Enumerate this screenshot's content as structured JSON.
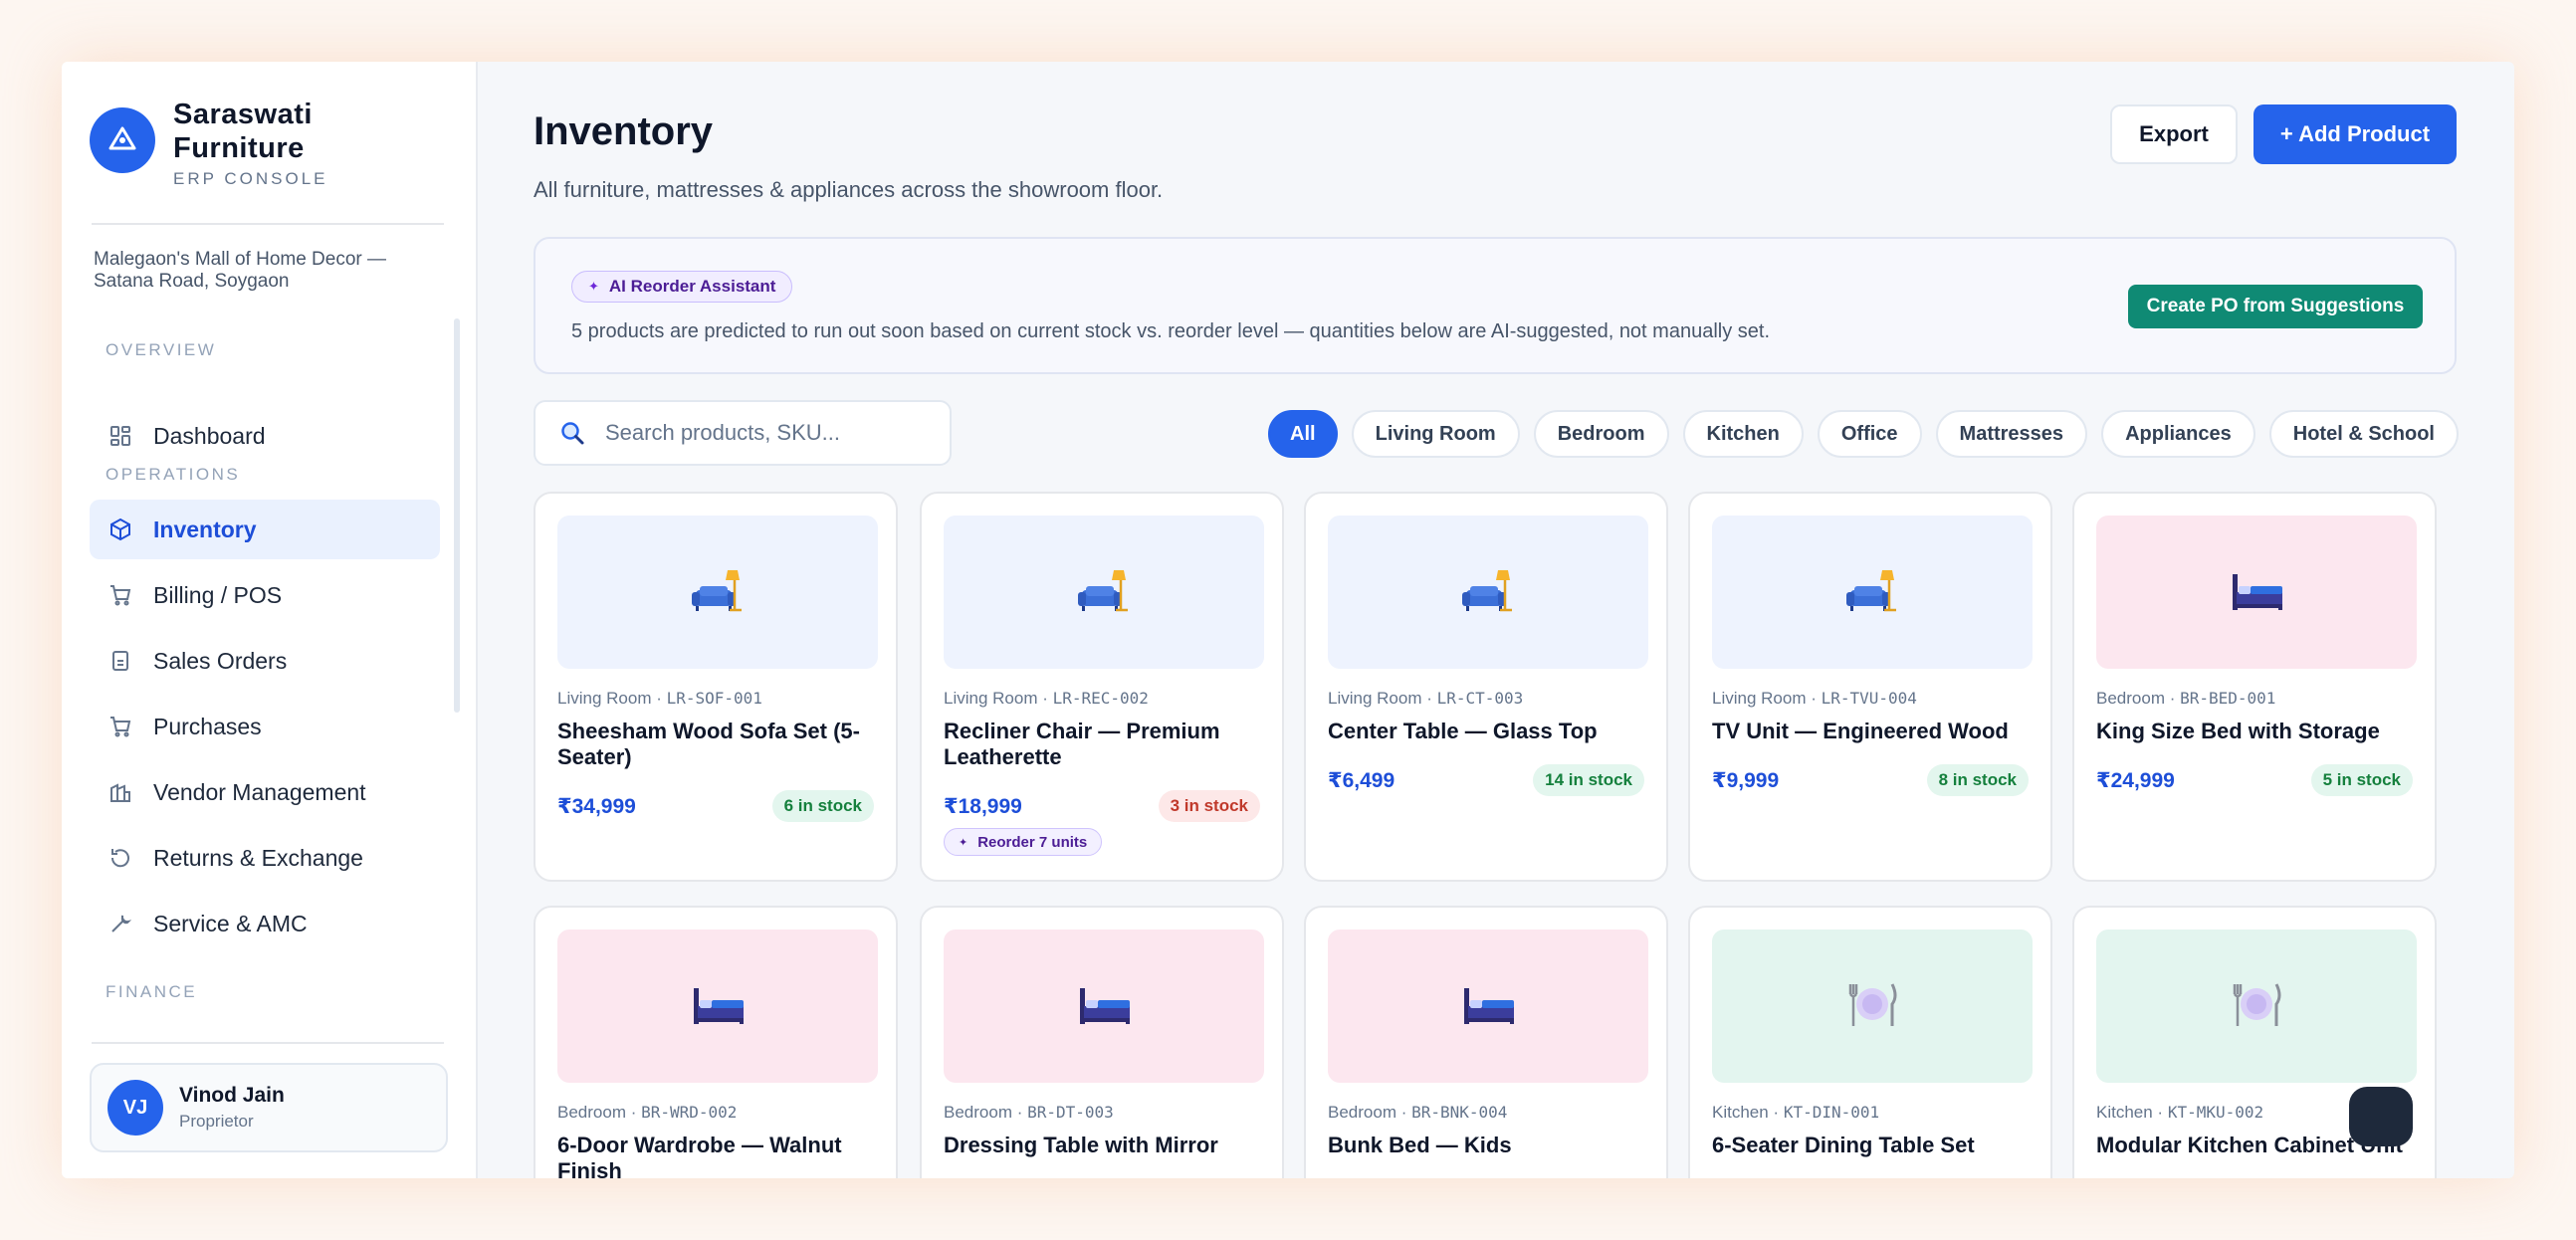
{
  "brand": {
    "name": "Saraswati Furniture",
    "subtitle": "ERP CONSOLE",
    "location": "Malegaon's Mall of Home Decor — Satana Road, Soygaon"
  },
  "sidebar": {
    "sections": {
      "overview": "OVERVIEW",
      "operations": "OPERATIONS",
      "finance": "FINANCE"
    },
    "items": [
      {
        "label": "Dashboard",
        "icon": "grid-icon"
      },
      {
        "label": "Inventory",
        "icon": "box-icon",
        "active": true
      },
      {
        "label": "Billing / POS",
        "icon": "cart-icon"
      },
      {
        "label": "Sales Orders",
        "icon": "document-icon"
      },
      {
        "label": "Purchases",
        "icon": "cart-icon"
      },
      {
        "label": "Vendor Management",
        "icon": "building-icon"
      },
      {
        "label": "Returns & Exchange",
        "icon": "refresh-icon"
      },
      {
        "label": "Service & AMC",
        "icon": "wrench-icon"
      }
    ]
  },
  "user": {
    "initials": "VJ",
    "name": "Vinod Jain",
    "role": "Proprietor"
  },
  "header": {
    "title": "Inventory",
    "subtitle": "All furniture, mattresses & appliances across the showroom floor.",
    "export_label": "Export",
    "add_label": "+ Add Product"
  },
  "ai": {
    "badge": "AI Reorder Assistant",
    "text": "5 products are predicted to run out soon based on current stock vs. reorder level — quantities below are AI-suggested, not manually set.",
    "button": "Create PO from Suggestions"
  },
  "search": {
    "placeholder": "Search products, SKU..."
  },
  "filters": [
    "All",
    "Living Room",
    "Bedroom",
    "Kitchen",
    "Office",
    "Mattresses",
    "Appliances",
    "Hotel & School"
  ],
  "active_filter": "All",
  "products": [
    {
      "category": "Living Room",
      "sku": "LR-SOF-001",
      "name": "Sheesham Wood Sofa Set (5-Seater)",
      "price": "₹34,999",
      "stock": "6 in stock",
      "status": "ok",
      "icon": "sofa-lamp-icon"
    },
    {
      "category": "Living Room",
      "sku": "LR-REC-002",
      "name": "Recliner Chair — Premium Leatherette",
      "price": "₹18,999",
      "stock": "3 in stock",
      "status": "low",
      "reorder": "Reorder 7 units",
      "icon": "sofa-lamp-icon"
    },
    {
      "category": "Living Room",
      "sku": "LR-CT-003",
      "name": "Center Table — Glass Top",
      "price": "₹6,499",
      "stock": "14 in stock",
      "status": "ok",
      "icon": "sofa-lamp-icon"
    },
    {
      "category": "Living Room",
      "sku": "LR-TVU-004",
      "name": "TV Unit — Engineered Wood",
      "price": "₹9,999",
      "stock": "8 in stock",
      "status": "ok",
      "icon": "sofa-lamp-icon"
    },
    {
      "category": "Bedroom",
      "sku": "BR-BED-001",
      "name": "King Size Bed with Storage",
      "price": "₹24,999",
      "stock": "5 in stock",
      "status": "ok",
      "icon": "bed-icon"
    },
    {
      "category": "Bedroom",
      "sku": "BR-WRD-002",
      "name": "6-Door Wardrobe — Walnut Finish",
      "icon": "bed-icon"
    },
    {
      "category": "Bedroom",
      "sku": "BR-DT-003",
      "name": "Dressing Table with Mirror",
      "icon": "bed-icon"
    },
    {
      "category": "Bedroom",
      "sku": "BR-BNK-004",
      "name": "Bunk Bed — Kids",
      "icon": "bed-icon"
    },
    {
      "category": "Kitchen",
      "sku": "KT-DIN-001",
      "name": "6-Seater Dining Table Set",
      "icon": "plate-cutlery-icon"
    },
    {
      "category": "Kitchen",
      "sku": "KT-MKU-002",
      "name": "Modular Kitchen Cabinet Unit",
      "icon": "plate-cutlery-icon"
    }
  ],
  "colors": {
    "accent": "#2563eb",
    "ai_button": "#0f8a74",
    "living_bg": "#eef3fe",
    "bedroom_bg": "#fce7ef",
    "kitchen_bg": "#e3f5ef",
    "stock_ok": "#15803d",
    "stock_low": "#c0392b"
  }
}
